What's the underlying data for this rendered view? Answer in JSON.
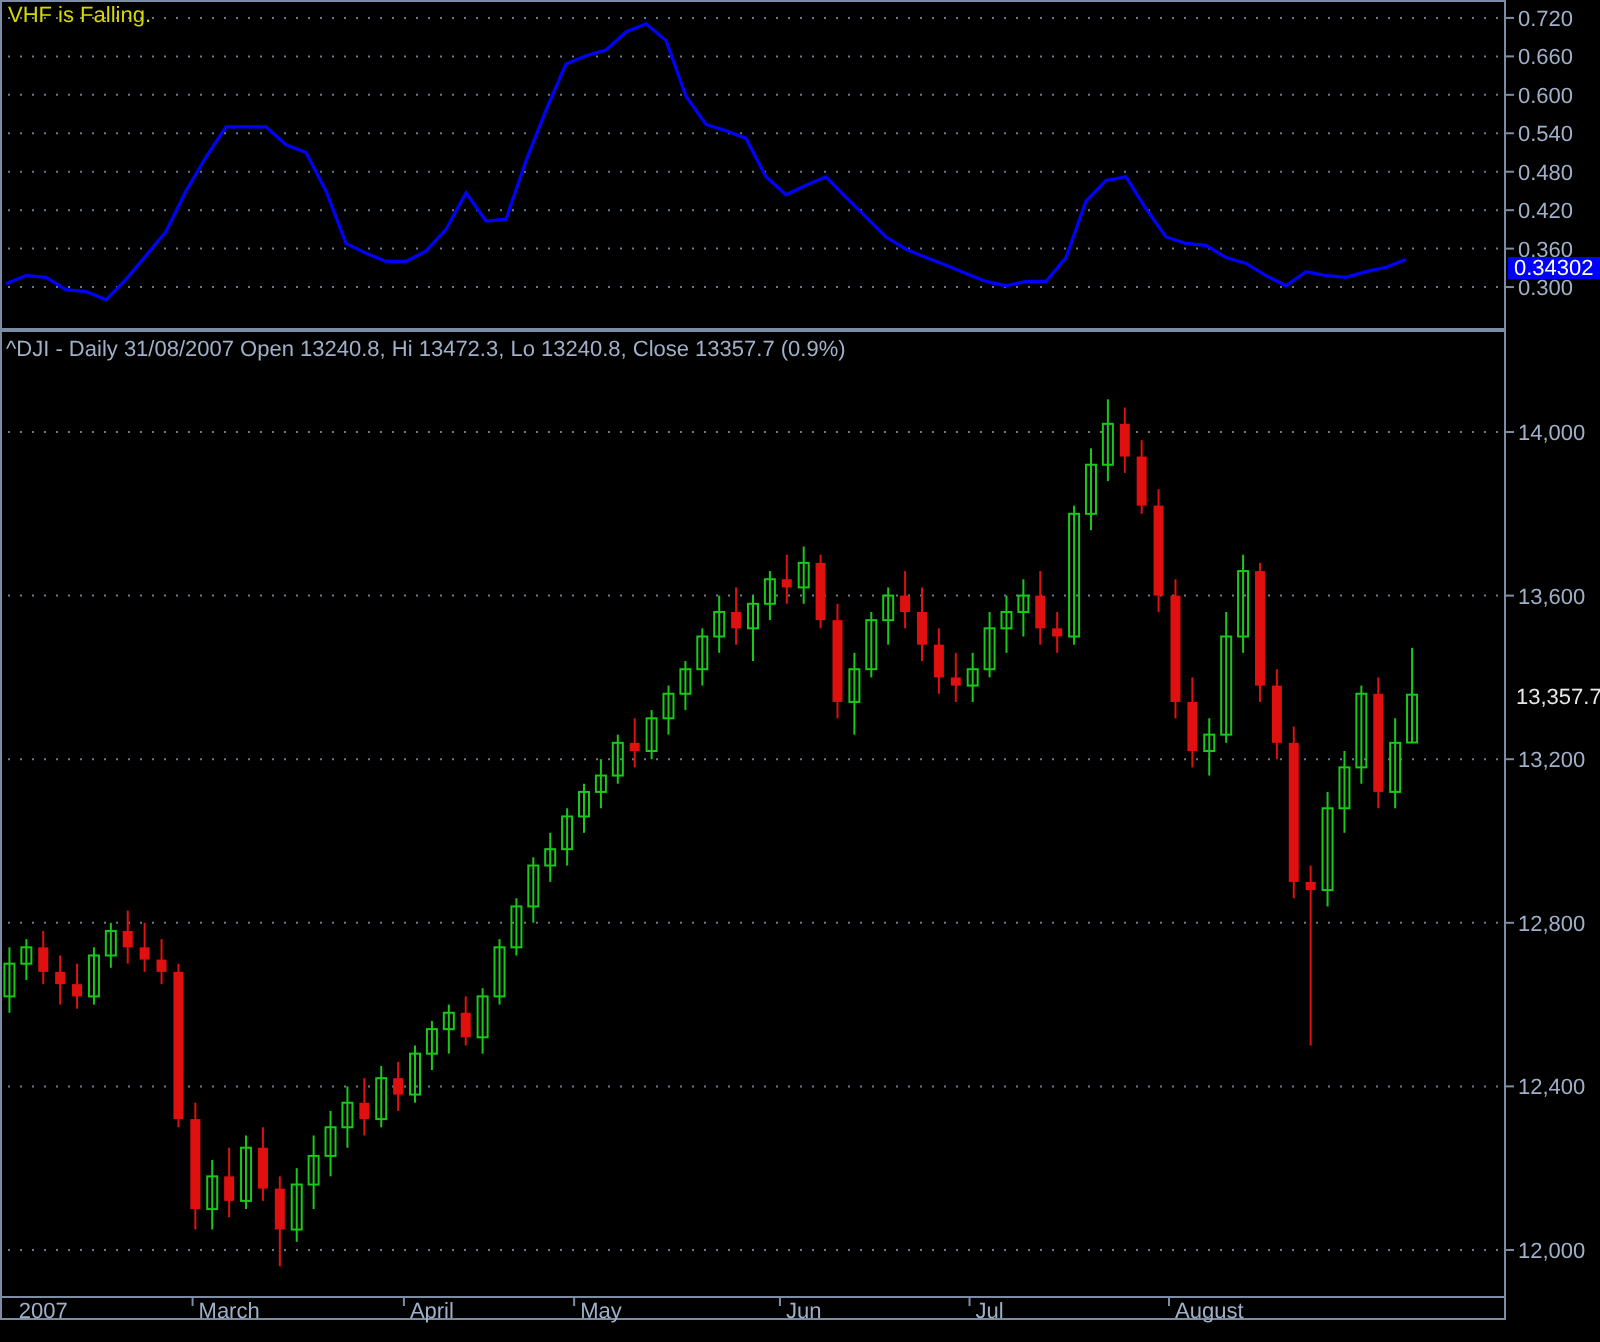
{
  "indicator": {
    "status": "VHF is Falling.",
    "chart_data": {
      "type": "line",
      "ylim": [
        0.233,
        0.748
      ],
      "grid": true,
      "yticks": [
        {
          "value": 0.3,
          "label": "0.300"
        },
        {
          "value": 0.36,
          "label": "0.360"
        },
        {
          "value": 0.42,
          "label": "0.420"
        },
        {
          "value": 0.48,
          "label": "0.480"
        },
        {
          "value": 0.54,
          "label": "0.540"
        },
        {
          "value": 0.6,
          "label": "0.600"
        },
        {
          "value": 0.66,
          "label": "0.660"
        },
        {
          "value": 0.72,
          "label": "0.720"
        }
      ],
      "series": [
        {
          "color": "#0000ff",
          "values": [
            0.305,
            0.318,
            0.315,
            0.296,
            0.293,
            0.28,
            0.312,
            0.349,
            0.387,
            0.45,
            0.503,
            0.55,
            0.55,
            0.55,
            0.522,
            0.51,
            0.45,
            0.368,
            0.353,
            0.34,
            0.34,
            0.356,
            0.39,
            0.447,
            0.403,
            0.406,
            0.497,
            0.576,
            0.648,
            0.661,
            0.67,
            0.698,
            0.711,
            0.685,
            0.598,
            0.554,
            0.544,
            0.532,
            0.472,
            0.444,
            0.459,
            0.472,
            0.44,
            0.409,
            0.378,
            0.359,
            0.346,
            0.334,
            0.321,
            0.309,
            0.302,
            0.309,
            0.309,
            0.346,
            0.434,
            0.466,
            0.472,
            0.422,
            0.378,
            0.368,
            0.365,
            0.346,
            0.337,
            0.318,
            0.302,
            0.324,
            0.318,
            0.315,
            0.324,
            0.331,
            0.343
          ]
        }
      ]
    },
    "last_value": "0.34302"
  },
  "price_chart": {
    "caption": "^DJI - Daily 31/08/2007 Open 13240.8, Hi 13472.3, Lo 13240.8, Close 13357.7 (0.9%)",
    "last_close": "13,357.7",
    "chart_data": {
      "type": "candlestick",
      "grid": true,
      "ylim": [
        11885,
        14247
      ],
      "yticks": [
        {
          "value": 14000,
          "label": "14,000"
        },
        {
          "value": 13600,
          "label": "13,600"
        },
        {
          "value": 13200,
          "label": "13,200"
        },
        {
          "value": 12800,
          "label": "12,800"
        },
        {
          "value": 12400,
          "label": "12,400"
        },
        {
          "value": 12000,
          "label": "12,000"
        }
      ],
      "categories": [
        null,
        null,
        "2007",
        null,
        null,
        null,
        null,
        null,
        null,
        null,
        null,
        null,
        null,
        "March",
        null,
        null,
        null,
        null,
        null,
        null,
        null,
        null,
        null,
        null,
        null,
        "April",
        null,
        null,
        null,
        null,
        null,
        null,
        null,
        null,
        null,
        "May",
        null,
        null,
        null,
        null,
        null,
        null,
        null,
        null,
        null,
        null,
        null,
        "Jun",
        null,
        null,
        null,
        null,
        null,
        null,
        null,
        null,
        null,
        null,
        "Jul",
        null,
        null,
        null,
        null,
        null,
        null,
        null,
        null,
        null,
        null,
        null,
        null,
        "August",
        null,
        null,
        null,
        null,
        null,
        null,
        null,
        null,
        null,
        null,
        null,
        null,
        null,
        null,
        null,
        null,
        null
      ],
      "ohlc": [
        [
          12620,
          12740,
          12580,
          12700
        ],
        [
          12700,
          12760,
          12660,
          12740
        ],
        [
          12740,
          12780,
          12650,
          12680
        ],
        [
          12680,
          12720,
          12600,
          12650
        ],
        [
          12650,
          12700,
          12590,
          12620
        ],
        [
          12620,
          12740,
          12600,
          12720
        ],
        [
          12720,
          12800,
          12690,
          12780
        ],
        [
          12780,
          12830,
          12700,
          12740
        ],
        [
          12740,
          12800,
          12680,
          12710
        ],
        [
          12710,
          12760,
          12650,
          12680
        ],
        [
          12680,
          12700,
          12300,
          12320
        ],
        [
          12320,
          12360,
          12050,
          12100
        ],
        [
          12100,
          12220,
          12050,
          12180
        ],
        [
          12180,
          12250,
          12080,
          12120
        ],
        [
          12120,
          12280,
          12100,
          12250
        ],
        [
          12250,
          12300,
          12120,
          12150
        ],
        [
          12150,
          12180,
          11960,
          12050
        ],
        [
          12050,
          12200,
          12020,
          12160
        ],
        [
          12160,
          12280,
          12100,
          12230
        ],
        [
          12230,
          12340,
          12180,
          12300
        ],
        [
          12300,
          12400,
          12250,
          12360
        ],
        [
          12360,
          12420,
          12280,
          12320
        ],
        [
          12320,
          12450,
          12300,
          12420
        ],
        [
          12420,
          12460,
          12340,
          12380
        ],
        [
          12380,
          12500,
          12360,
          12480
        ],
        [
          12480,
          12560,
          12440,
          12540
        ],
        [
          12540,
          12600,
          12480,
          12580
        ],
        [
          12580,
          12620,
          12500,
          12520
        ],
        [
          12520,
          12640,
          12480,
          12620
        ],
        [
          12620,
          12760,
          12600,
          12740
        ],
        [
          12740,
          12860,
          12720,
          12840
        ],
        [
          12840,
          12960,
          12800,
          12940
        ],
        [
          12940,
          13020,
          12900,
          12980
        ],
        [
          12980,
          13080,
          12940,
          13060
        ],
        [
          13060,
          13140,
          13020,
          13120
        ],
        [
          13120,
          13200,
          13080,
          13160
        ],
        [
          13160,
          13260,
          13140,
          13240
        ],
        [
          13240,
          13300,
          13180,
          13220
        ],
        [
          13220,
          13320,
          13200,
          13300
        ],
        [
          13300,
          13380,
          13260,
          13360
        ],
        [
          13360,
          13440,
          13320,
          13420
        ],
        [
          13420,
          13520,
          13380,
          13500
        ],
        [
          13500,
          13600,
          13460,
          13560
        ],
        [
          13560,
          13620,
          13480,
          13520
        ],
        [
          13520,
          13600,
          13440,
          13580
        ],
        [
          13580,
          13660,
          13540,
          13640
        ],
        [
          13640,
          13700,
          13580,
          13620
        ],
        [
          13620,
          13720,
          13580,
          13680
        ],
        [
          13680,
          13700,
          13520,
          13540
        ],
        [
          13540,
          13580,
          13300,
          13340
        ],
        [
          13340,
          13460,
          13260,
          13420
        ],
        [
          13420,
          13560,
          13400,
          13540
        ],
        [
          13540,
          13620,
          13480,
          13600
        ],
        [
          13600,
          13660,
          13520,
          13560
        ],
        [
          13560,
          13620,
          13440,
          13480
        ],
        [
          13480,
          13520,
          13360,
          13400
        ],
        [
          13400,
          13460,
          13340,
          13380
        ],
        [
          13380,
          13460,
          13340,
          13420
        ],
        [
          13420,
          13560,
          13400,
          13520
        ],
        [
          13520,
          13600,
          13460,
          13560
        ],
        [
          13560,
          13640,
          13500,
          13600
        ],
        [
          13600,
          13660,
          13480,
          13520
        ],
        [
          13520,
          13560,
          13460,
          13500
        ],
        [
          13500,
          13820,
          13480,
          13800
        ],
        [
          13800,
          13960,
          13760,
          13920
        ],
        [
          13920,
          14080,
          13880,
          14020
        ],
        [
          14020,
          14060,
          13900,
          13940
        ],
        [
          13940,
          13980,
          13800,
          13820
        ],
        [
          13820,
          13860,
          13560,
          13600
        ],
        [
          13600,
          13640,
          13300,
          13340
        ],
        [
          13340,
          13400,
          13180,
          13220
        ],
        [
          13220,
          13300,
          13160,
          13260
        ],
        [
          13260,
          13560,
          13240,
          13500
        ],
        [
          13500,
          13700,
          13460,
          13660
        ],
        [
          13660,
          13680,
          13340,
          13380
        ],
        [
          13380,
          13420,
          13200,
          13240
        ],
        [
          13240,
          13280,
          12860,
          12900
        ],
        [
          12900,
          12940,
          12500,
          12880
        ],
        [
          12880,
          13120,
          12840,
          13080
        ],
        [
          13080,
          13220,
          13020,
          13180
        ],
        [
          13180,
          13380,
          13140,
          13360
        ],
        [
          13360,
          13400,
          13080,
          13120
        ],
        [
          13120,
          13300,
          13080,
          13240
        ],
        [
          13240.8,
          13472.3,
          13240.8,
          13357.7
        ],
        null,
        null,
        null,
        null,
        null
      ]
    }
  }
}
